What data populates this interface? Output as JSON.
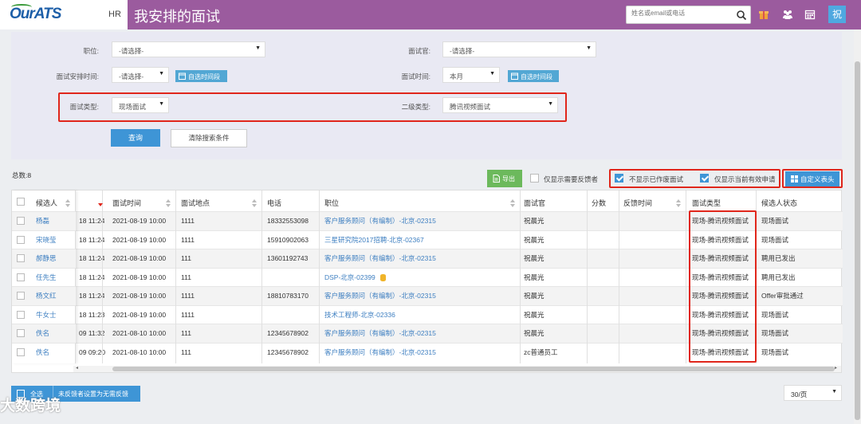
{
  "header": {
    "logo": "OurATS",
    "module": "HR",
    "page_title": "我安排的面试",
    "search_placeholder": "姓名或email或电话",
    "avatar": "祝"
  },
  "filters": {
    "position_label": "职位:",
    "position_value": "-请选择-",
    "interviewer_label": "面试官:",
    "interviewer_value": "-请选择-",
    "schedule_time_label": "面试安排时间:",
    "schedule_time_value": "-请选择-",
    "schedule_custom_btn": "自选时间段",
    "interview_time_label": "面试时间:",
    "interview_time_value": "本月",
    "interview_custom_btn": "自选时间段",
    "type_label": "面试类型:",
    "type_value": "现场面试",
    "subtype_label": "二级类型:",
    "subtype_value": "腾讯视频面试",
    "query_btn": "查询",
    "clear_btn": "清除搜索条件"
  },
  "toolbar": {
    "total": "总数:8",
    "export_btn": "导出",
    "need_feedback_label": "仅显示需要反馈者",
    "hide_invalid_label": "不显示已作废面试",
    "valid_only_label": "仅显示当前有效申请",
    "custom_columns_btn": "自定义表头"
  },
  "table": {
    "headers": [
      "候选人",
      "",
      "面试时间",
      "面试地点",
      "电话",
      "职位",
      "面试官",
      "分数",
      "反馈时间",
      "面试类型",
      "候选人状态"
    ],
    "rows": [
      {
        "candidate": "杨磊",
        "created": "18 11:24",
        "time": "2021-08-19 10:00",
        "place": "1111",
        "phone": "18332553098",
        "position": "客户服务顾问（有编制）-北京-02315",
        "interviewer": "祝晨光",
        "score": "",
        "feedback": "",
        "type": "现场-腾讯视频面试",
        "status": "现场面试"
      },
      {
        "candidate": "宋晓莹",
        "created": "18 11:24",
        "time": "2021-08-19 10:00",
        "place": "1111",
        "phone": "15910902063",
        "position": "三星研究院2017招聘-北京-02367",
        "interviewer": "祝晨光",
        "score": "",
        "feedback": "",
        "type": "现场-腾讯视频面试",
        "status": "现场面试"
      },
      {
        "candidate": "郝静思",
        "created": "18 11:24",
        "time": "2021-08-19 10:00",
        "place": "111",
        "phone": "13601192743",
        "position": "客户服务顾问（有编制）-北京-02315",
        "interviewer": "祝晨光",
        "score": "",
        "feedback": "",
        "type": "现场-腾讯视频面试",
        "status": "聘用已发出"
      },
      {
        "candidate": "任先生",
        "created": "18 11:24",
        "time": "2021-08-19 10:00",
        "place": "111",
        "phone": "",
        "position": "DSP-北京-02399",
        "interviewer": "祝晨光",
        "score": "",
        "feedback": "",
        "type": "现场-腾讯视频面试",
        "status": "聘用已发出"
      },
      {
        "candidate": "杨文红",
        "created": "18 11:24",
        "time": "2021-08-19 10:00",
        "place": "1111",
        "phone": "18810783170",
        "position": "客户服务顾问（有编制）-北京-02315",
        "interviewer": "祝晨光",
        "score": "",
        "feedback": "",
        "type": "现场-腾讯视频面试",
        "status": "Offer审批通过"
      },
      {
        "candidate": "牛女士",
        "created": "18 11:23",
        "time": "2021-08-19 10:00",
        "place": "1111",
        "phone": "",
        "position": "技术工程师-北京-02336",
        "interviewer": "祝晨光",
        "score": "",
        "feedback": "",
        "type": "现场-腾讯视频面试",
        "status": "现场面试"
      },
      {
        "candidate": "佚名",
        "created": "09 11:32",
        "time": "2021-08-10 10:00",
        "place": "111",
        "phone": "12345678902",
        "position": "客户服务顾问（有编制）-北京-02315",
        "interviewer": "祝晨光",
        "score": "",
        "feedback": "",
        "type": "现场-腾讯视频面试",
        "status": "现场面试"
      },
      {
        "candidate": "佚名",
        "created": "09 09:20",
        "time": "2021-08-10 10:00",
        "place": "111",
        "phone": "12345678902",
        "position": "客户服务顾问（有编制）-北京-02315",
        "interviewer": "zc普通员工",
        "score": "",
        "feedback": "",
        "type": "现场-腾讯视频面试",
        "status": "现场面试"
      }
    ]
  },
  "footer": {
    "select_all": "全选",
    "no_feedback_btn": "未反馈者设置为无需反馈",
    "page_size": "30/页"
  },
  "watermark": "大数跨境",
  "colors": {
    "header": "#9b5b9e",
    "primary": "#3e95d6",
    "export": "#6cb95c",
    "highlight": "#e0261b"
  }
}
